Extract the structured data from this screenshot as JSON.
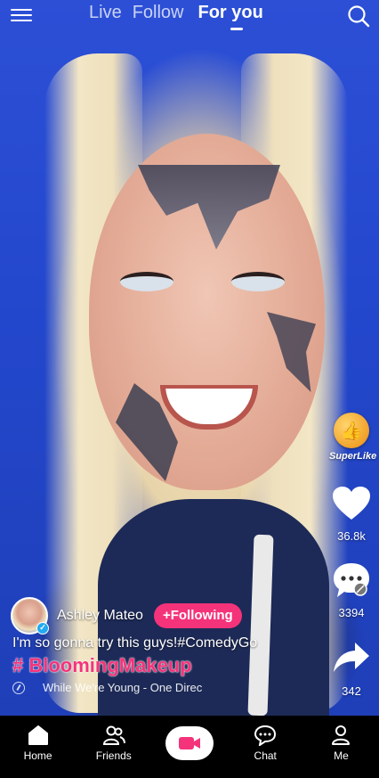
{
  "header": {
    "tabs": [
      {
        "label": "Live"
      },
      {
        "label": "Follow"
      },
      {
        "label": "For you",
        "active": true
      }
    ],
    "icons": {
      "menu": "hamburger-menu-icon",
      "search": "search-icon"
    }
  },
  "actions": {
    "superlike_label": "SuperLike",
    "likes": "36.8k",
    "comments": "3394",
    "shares": "342"
  },
  "post": {
    "author": "Ashley Mateo",
    "follow_label": "+Following",
    "caption": "I'm so gonna try this guys!#ComedyGo",
    "hashtag": "# BloomingMakeup",
    "music": "While We're Young - One Direc"
  },
  "nav": {
    "items": [
      {
        "label": "Home",
        "icon": "home-icon"
      },
      {
        "label": "Friends",
        "icon": "friends-icon"
      },
      {
        "label": "",
        "icon": "camera-icon"
      },
      {
        "label": "Chat",
        "icon": "chat-icon"
      },
      {
        "label": "Me",
        "icon": "profile-icon"
      }
    ]
  },
  "colors": {
    "accent": "#f4337a",
    "background": "#2347cc",
    "nav_bg": "#000000"
  }
}
